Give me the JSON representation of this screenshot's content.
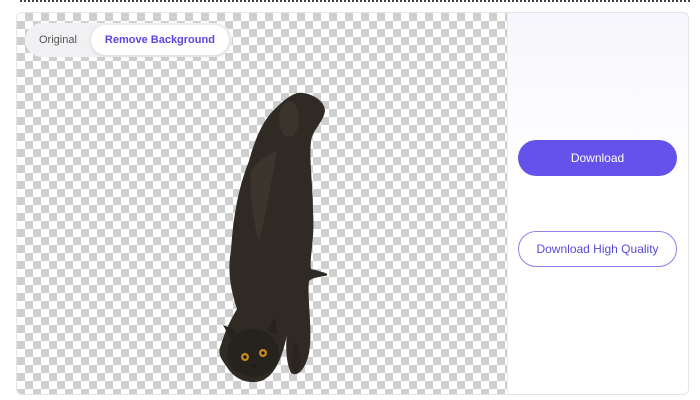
{
  "tabs": {
    "original_label": "Original",
    "remove_bg_label": "Remove Background",
    "active": "Remove Background"
  },
  "actions": {
    "download_label": "Download",
    "download_hq_label": "Download High Quality"
  },
  "colors": {
    "accent": "#6552ea",
    "outline": "#8d82ea",
    "checker": "#cfcfcf"
  },
  "preview": {
    "subject": "cat"
  }
}
